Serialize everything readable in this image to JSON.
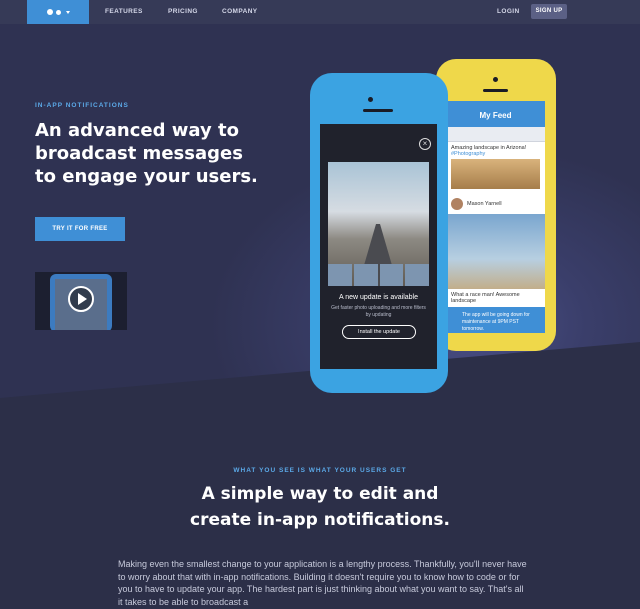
{
  "nav": {
    "links": [
      "FEATURES",
      "PRICING",
      "COMPANY"
    ],
    "login": "LOGIN",
    "signup": "SIGN UP"
  },
  "hero": {
    "eyebrow": "IN-APP NOTIFICATIONS",
    "headline": [
      "An advanced way to",
      "broadcast messages",
      "to engage your users."
    ],
    "cta": "TRY IT FOR FREE"
  },
  "phone_blue": {
    "notice_title": "A new update is available",
    "notice_text": "Get faster photo uploading and more filters by updating",
    "button": "Install the update"
  },
  "phone_yellow": {
    "title": "My Feed",
    "post1": "Amazing landscape in Arizona!",
    "post1_tag": "#Photography",
    "user": "Mason Yarnell",
    "post2": "What a race man! Awesome landscape",
    "notice": "The app will be going down for maintenance at 9PM PST tomorrow."
  },
  "section2": {
    "eyebrow": "WHAT YOU SEE IS WHAT YOUR USERS GET",
    "title": [
      "A simple way to edit and",
      "create in-app notifications."
    ],
    "paragraph": "Making even the smallest change to your application is a lengthy process. Thankfully, you'll never have to worry about that with in-app notifications. Building it doesn't require you to know how to code or for you to have to update your app. The hardest part is just thinking about what you want to say. That's all it takes to be able to broadcast a"
  },
  "colors": {
    "background": "#2c2f48",
    "accent": "#3f8fd6",
    "eyebrow": "#5ba9e8",
    "phone_blue": "#3ba3e2",
    "phone_yellow": "#efd84a"
  },
  "icons": [
    "logo-dots-icon",
    "play-icon",
    "close-icon"
  ]
}
